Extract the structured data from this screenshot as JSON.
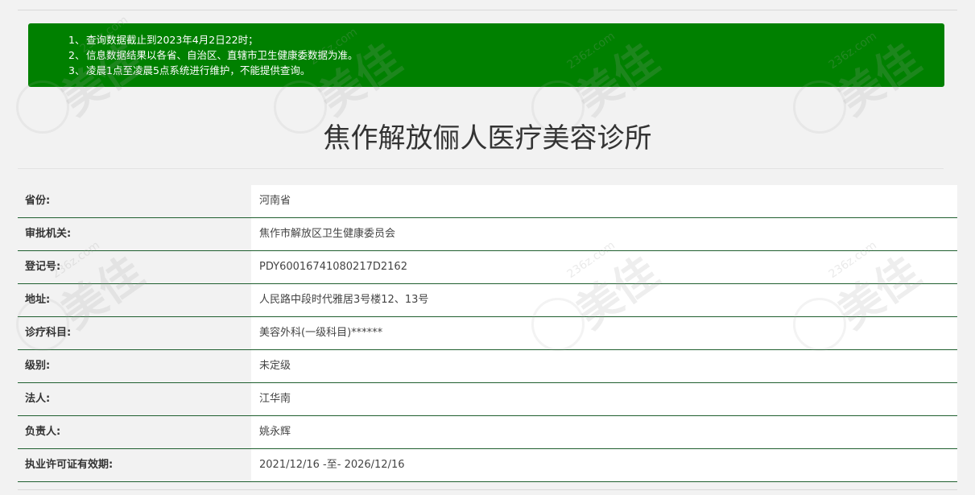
{
  "notice": {
    "lines": [
      {
        "num": "1、",
        "text": "查询数据截止到2023年4月2日22时；"
      },
      {
        "num": "2、",
        "text": "信息数据结果以各省、自治区、直辖市卫生健康委数据为准。"
      },
      {
        "num": "3、",
        "text": "凌晨1点至凌晨5点系统进行维护，不能提供查询。"
      }
    ],
    "background_color": "#008000"
  },
  "page_title": "焦作解放俪人医疗美容诊所",
  "table": {
    "rows": [
      {
        "label": "省份:",
        "value": "河南省"
      },
      {
        "label": "审批机关:",
        "value": "焦作市解放区卫生健康委员会"
      },
      {
        "label": "登记号:",
        "value": "PDY60016741080217D2162"
      },
      {
        "label": "地址:",
        "value": "人民路中段时代雅居3号楼12、13号"
      },
      {
        "label": "诊疗科目:",
        "value": "美容外科(一级科目)******"
      },
      {
        "label": "级别:",
        "value": "未定级"
      },
      {
        "label": "法人:",
        "value": "江华南"
      },
      {
        "label": "负责人:",
        "value": "姚永辉"
      },
      {
        "label": "执业许可证有效期:",
        "value": "2021/12/16 -至- 2026/12/16"
      }
    ],
    "row_border_color": "#1f5f2f"
  },
  "watermark": {
    "brand": "美佳",
    "domain": "236z.com"
  }
}
